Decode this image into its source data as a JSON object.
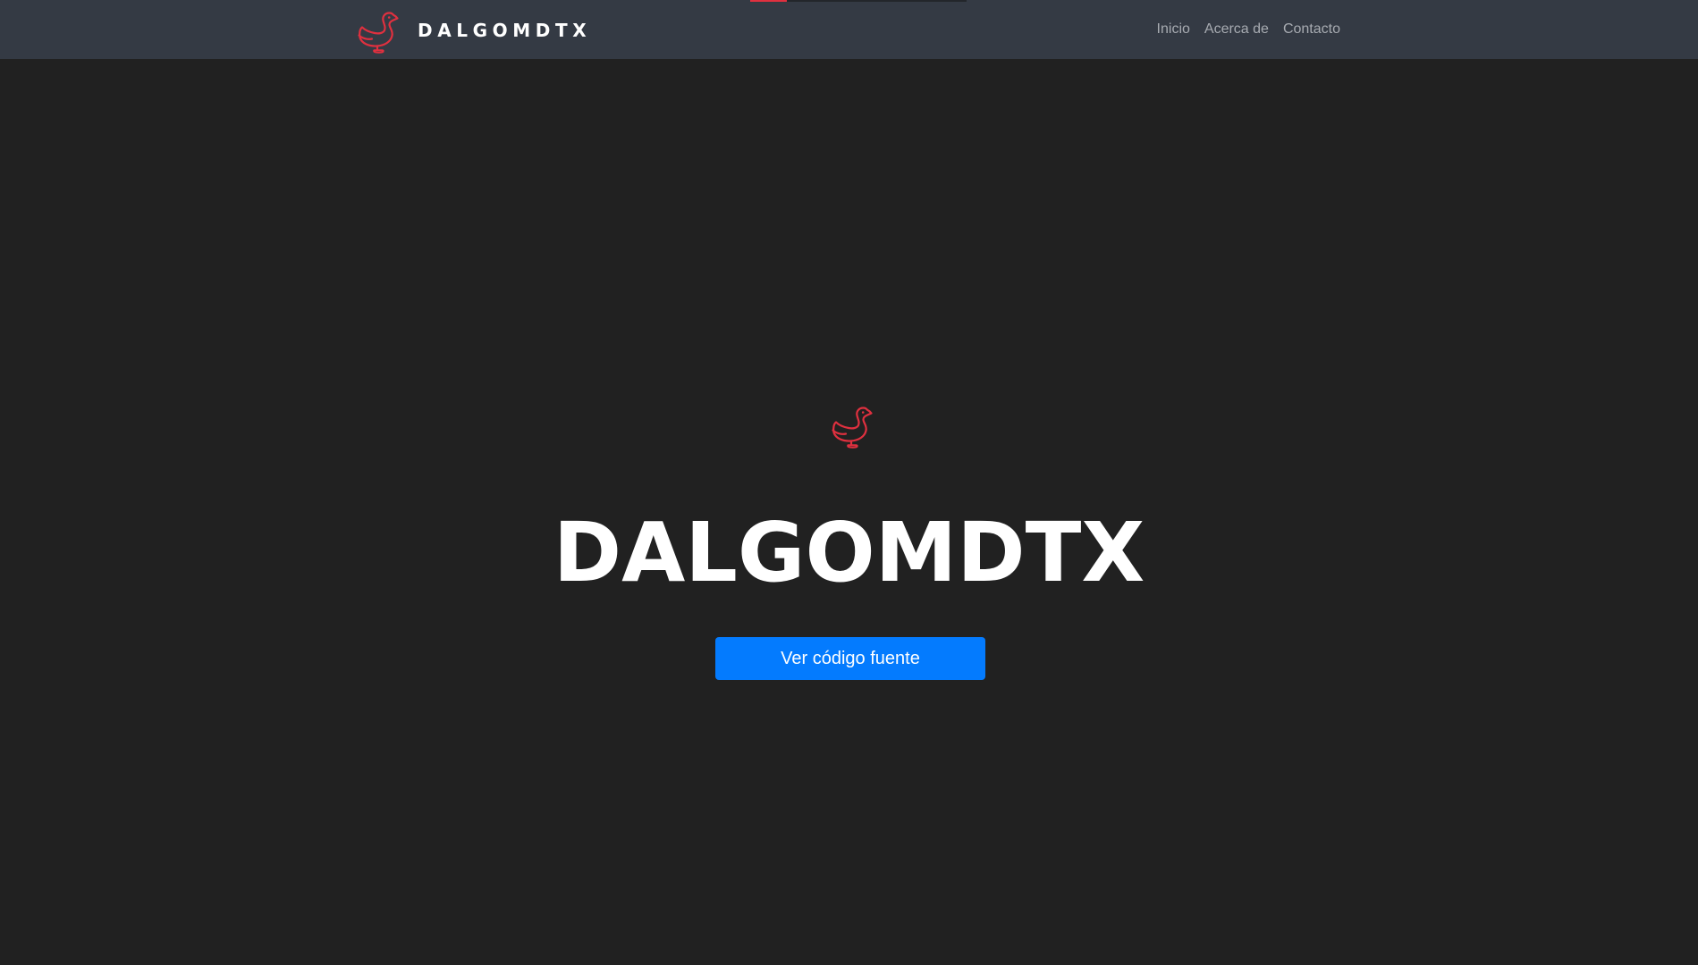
{
  "brand": {
    "name": "DALGOMDTX",
    "logo_icon": "duck-icon",
    "accent_color": "#e0303f"
  },
  "scroll_progress": {
    "value": 0.17
  },
  "nav": {
    "items": [
      {
        "label": "Inicio"
      },
      {
        "label": "Acerca de"
      },
      {
        "label": "Contacto"
      }
    ]
  },
  "hero": {
    "logo_icon": "duck-icon",
    "title": "DALGOMDTX",
    "button_label": "Ver código fuente",
    "button_color": "#047bfe"
  }
}
